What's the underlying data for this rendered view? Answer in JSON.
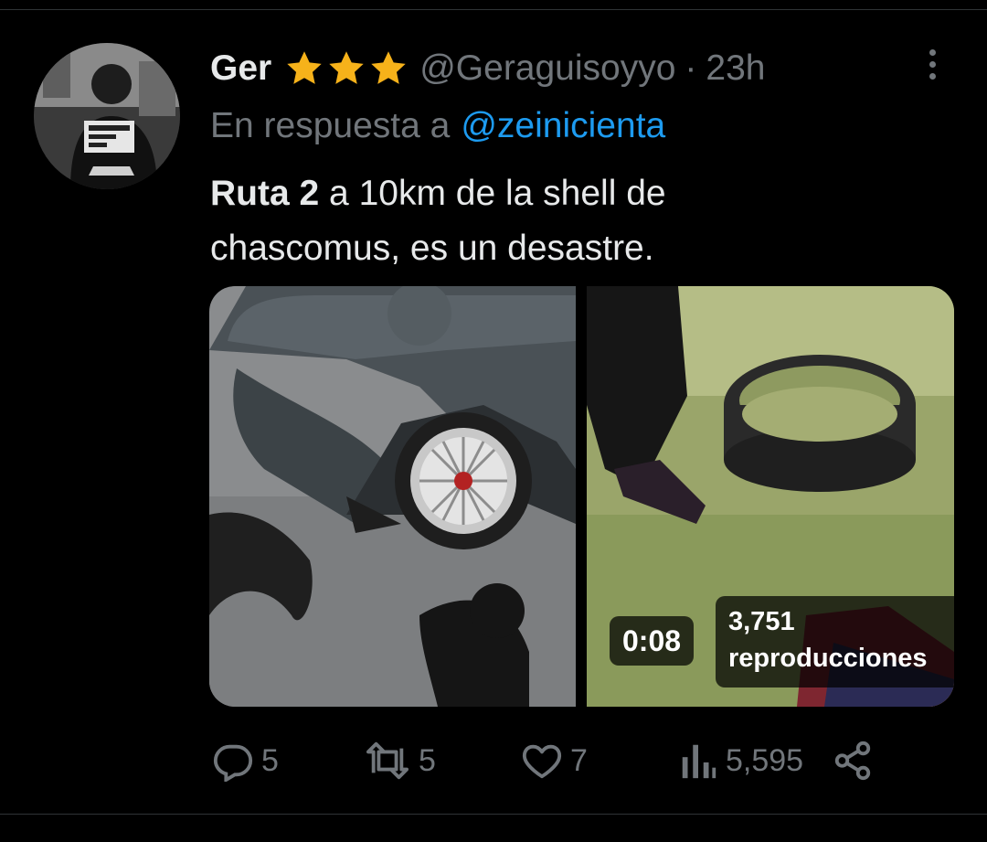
{
  "tweet": {
    "author": {
      "name": "Ger",
      "badges": [
        "star-icon",
        "star-icon",
        "star-icon"
      ],
      "handle": "@Geraguisoyyo",
      "separator": "·",
      "time": "23h"
    },
    "reply_to": {
      "prefix": "En respuesta a",
      "handle": "@zeinicienta"
    },
    "text": {
      "bold": "Ruta 2",
      "line1_rest": " a 10km de la shell de",
      "line2": "chascomus, es un desastre."
    },
    "media": {
      "video_duration": "0:08",
      "view_count": "3,751",
      "view_label": "reproducciones"
    },
    "actions": {
      "reply_count": "5",
      "retweet_count": "5",
      "like_count": "7",
      "view_count": "5,595"
    }
  },
  "icons": {
    "reply": "reply-icon",
    "retweet": "retweet-icon",
    "like": "heart-icon",
    "views": "bar-chart-icon",
    "share": "share-icon",
    "more": "more-vertical-icon"
  },
  "colors": {
    "background": "#000000",
    "text": "#e7e9ea",
    "secondary": "#71767b",
    "link": "#1d9bf0",
    "star": "#f6b21a"
  }
}
